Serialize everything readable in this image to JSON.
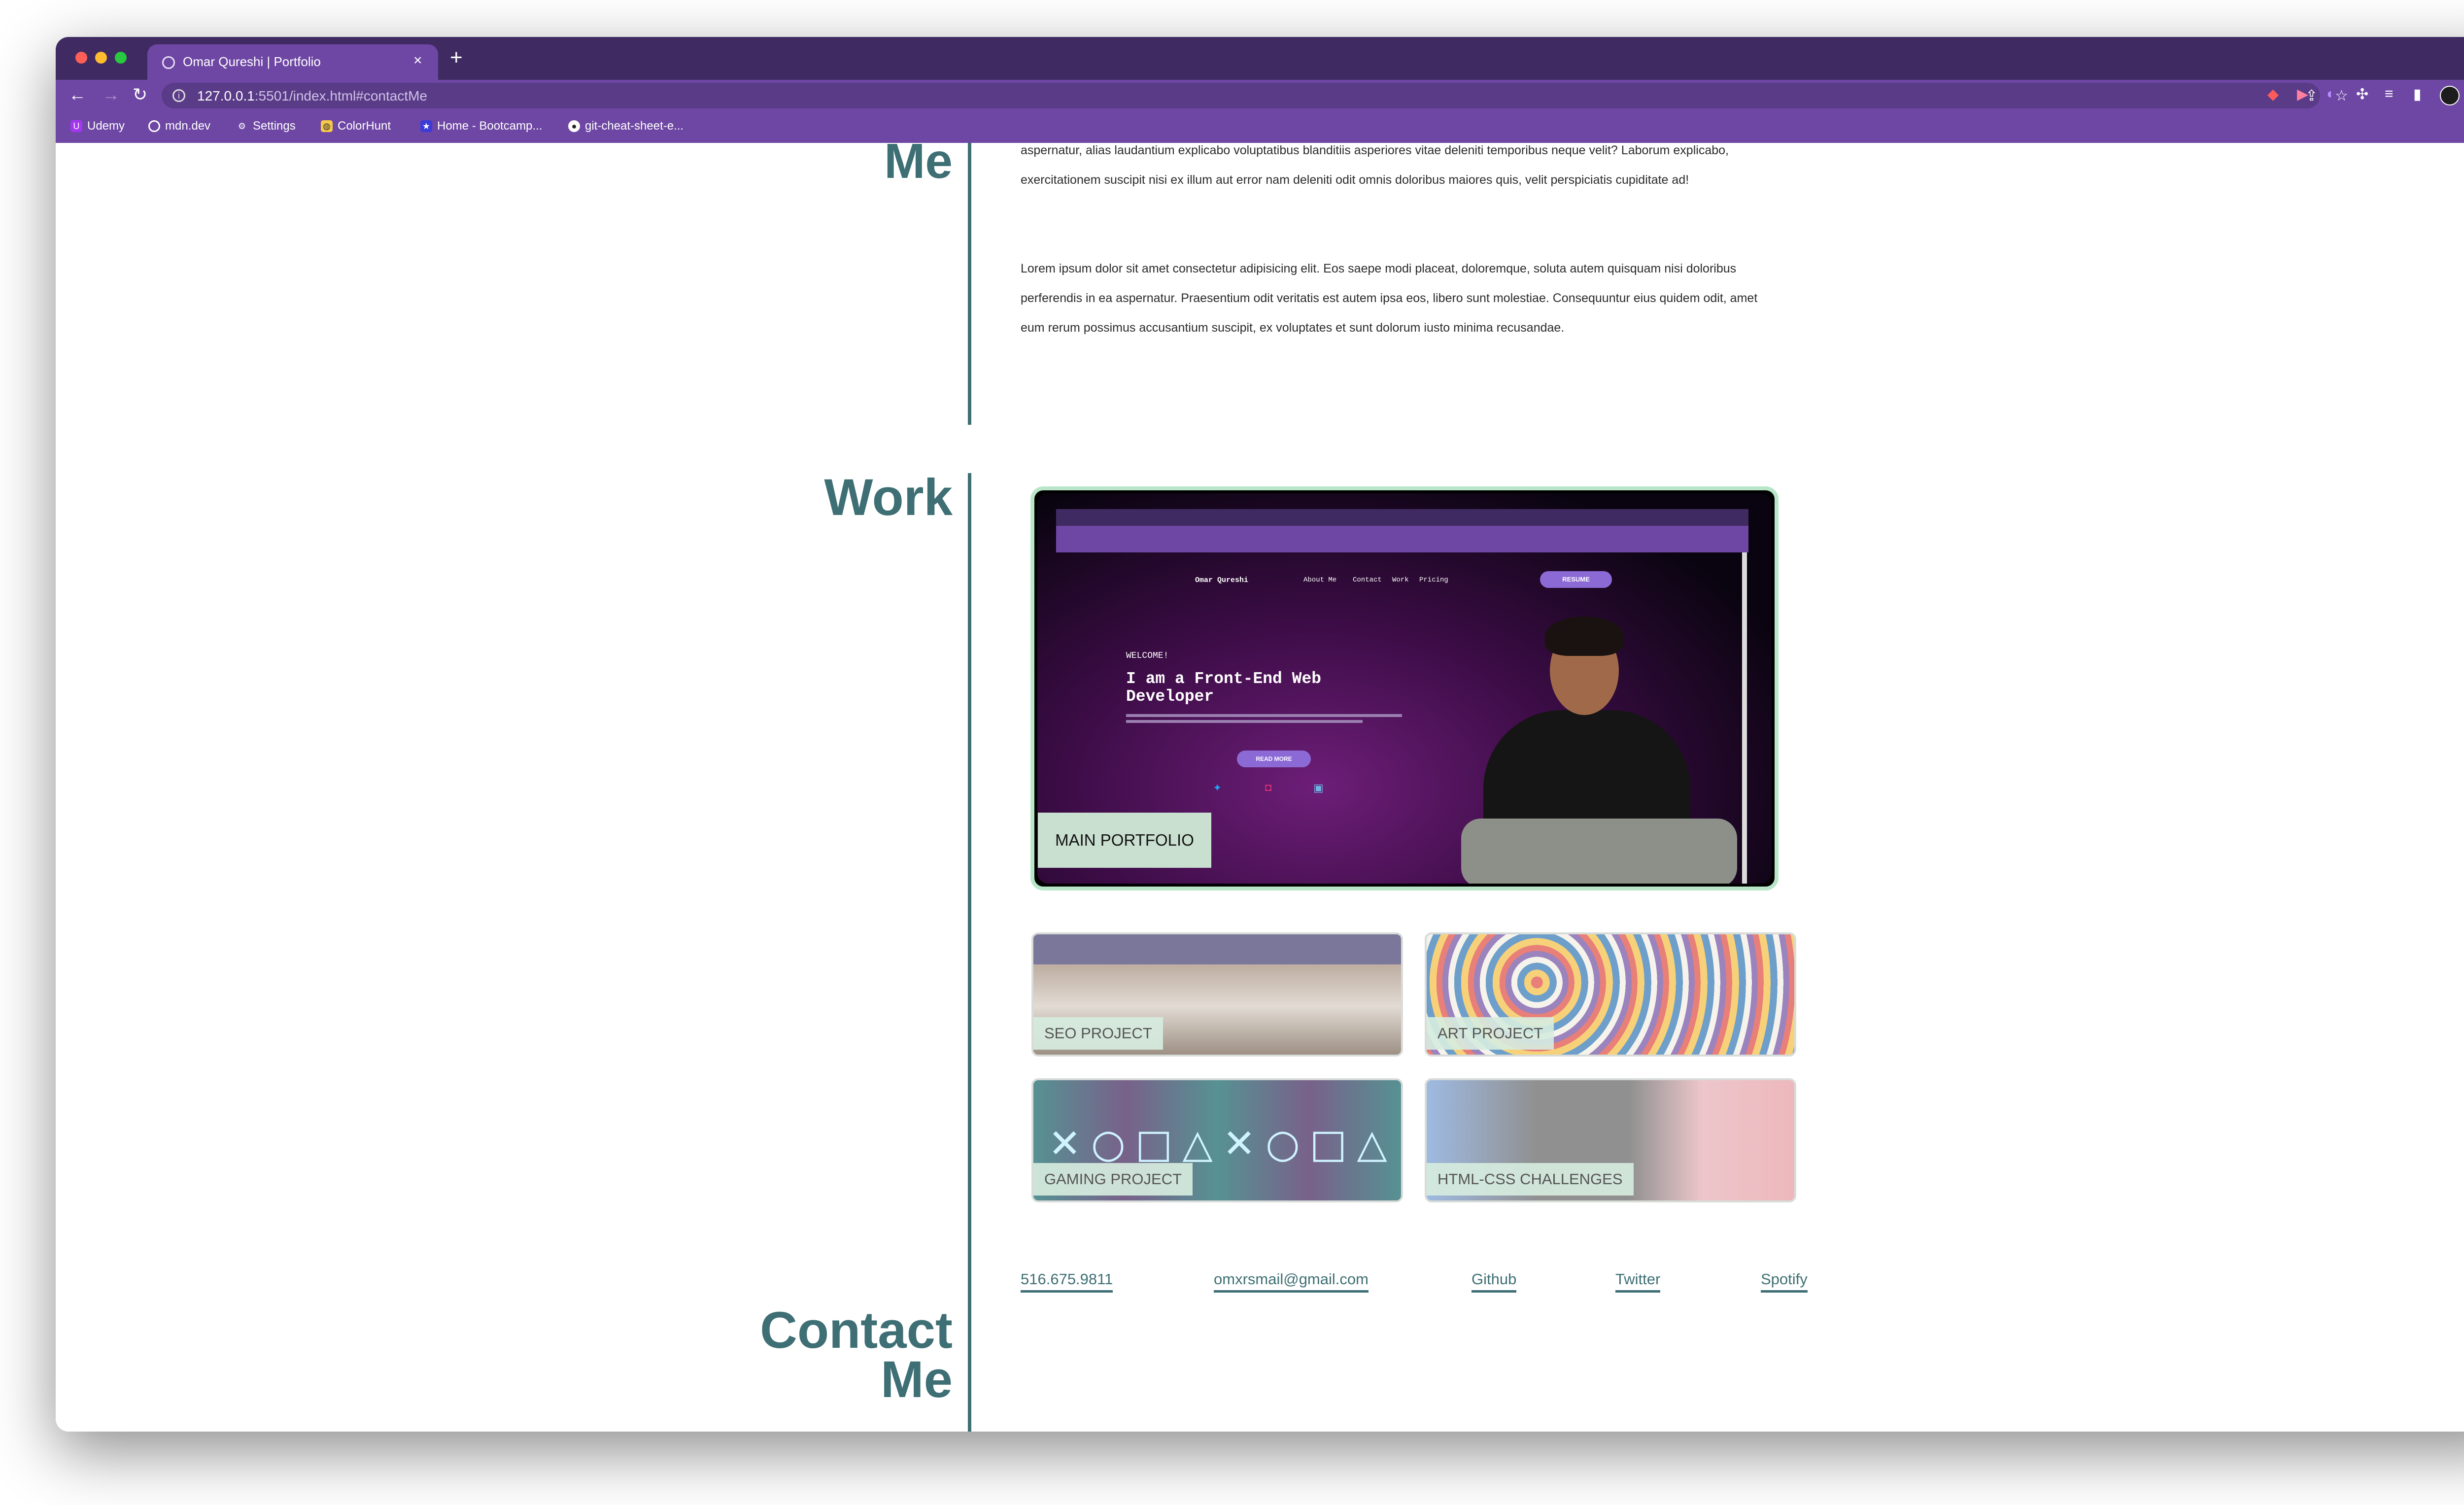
{
  "browser": {
    "tab_title": "Omar Qureshi | Portfolio",
    "url_host": "127.0.0.1",
    "url_rest": ":5501/index.html#contactMe",
    "bookmarks": [
      "Udemy",
      "mdn.dev",
      "Settings",
      "ColorHunt",
      "Home - Bootcamp...",
      "git-cheat-sheet-e..."
    ]
  },
  "about": {
    "heading_tail": "Me",
    "paragraph1_line1": "aspernatur, alias laudantium explicabo voluptatibus blanditiis asperiores vitae deleniti temporibus neque velit? Laborum explicabo,",
    "paragraph1_line2": "exercitationem suscipit nisi ex illum aut error nam deleniti odit omnis doloribus maiores quis, velit perspiciatis cupiditate ad!",
    "paragraph2_line1": "Lorem ipsum dolor sit amet consectetur adipisicing elit. Eos saepe modi placeat, doloremque, soluta autem quisquam nisi doloribus",
    "paragraph2_line2": "perferendis in ea aspernatur. Praesentium odit veritatis est autem ipsa eos, libero sunt molestiae. Consequuntur eius quidem odit, amet",
    "paragraph2_line3": "eum rerum possimus accusantium suscipit, ex voluptates et sunt dolorum iusto minima recusandae."
  },
  "work": {
    "heading": "Work",
    "featured": {
      "label": "MAIN PORTFOLIO",
      "preview": {
        "brand": "Omar Qureshi",
        "nav": [
          "About Me",
          "Contact",
          "Work",
          "Pricing"
        ],
        "resume_button": "RESUME",
        "welcome": "WELCOME!",
        "headline_line1": "I am a Front-End Web",
        "headline_line2": "Developer",
        "read_more": "READ MORE"
      }
    },
    "projects": [
      {
        "label": "SEO PROJECT"
      },
      {
        "label": "ART PROJECT"
      },
      {
        "label": "GAMING PROJECT"
      },
      {
        "label": "HTML-CSS CHALLENGES"
      }
    ]
  },
  "contact": {
    "heading_line1": "Contact",
    "heading_line2": "Me",
    "links": [
      {
        "label": "516.675.9811"
      },
      {
        "label": "omxrsmail@gmail.com"
      },
      {
        "label": "Github"
      },
      {
        "label": "Twitter"
      },
      {
        "label": "Spotify"
      }
    ]
  },
  "colors": {
    "accent": "#3e6f74",
    "browser_frame": "#6e47a4",
    "browser_tabbar": "#3f2b61",
    "card_label": "#c9dfcf"
  }
}
